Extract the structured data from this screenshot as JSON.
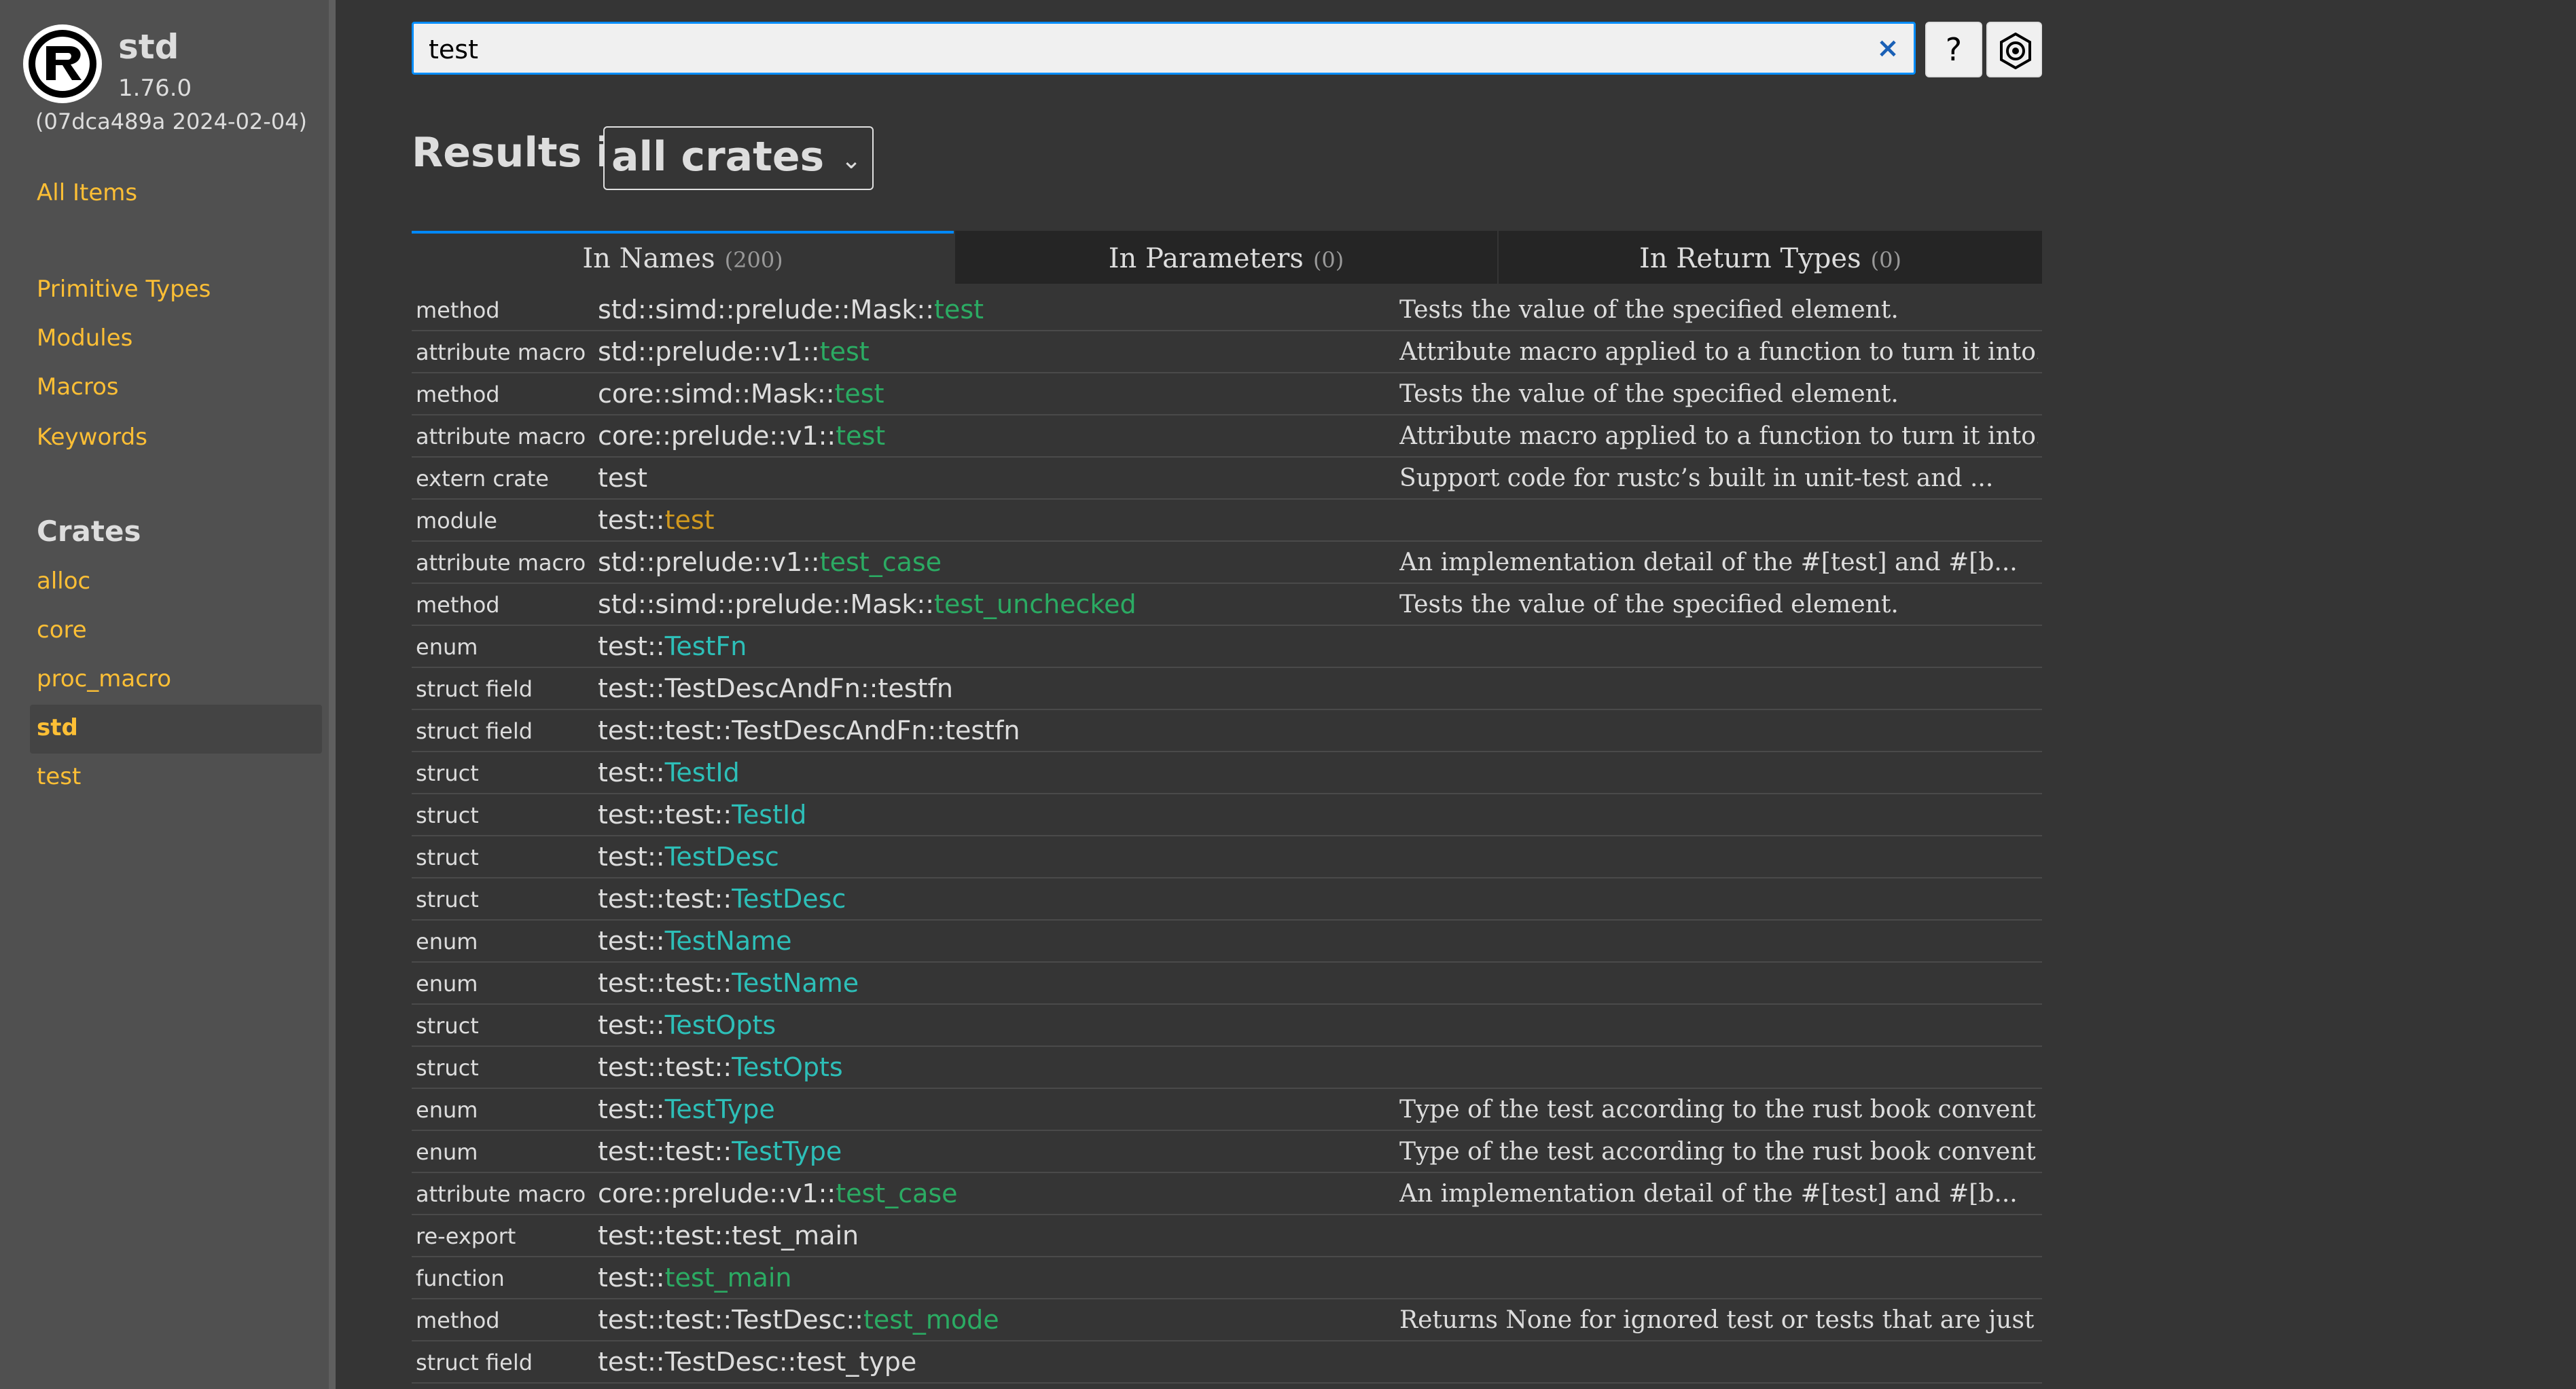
{
  "sidebar": {
    "crate_name": "std",
    "version": "1.76.0",
    "hash": "(07dca489a 2024-02-04)",
    "all_items": "All Items",
    "sections": [
      "Primitive Types",
      "Modules",
      "Macros",
      "Keywords"
    ],
    "crates_heading": "Crates",
    "crates": [
      "alloc",
      "core",
      "proc_macro",
      "std",
      "test"
    ],
    "current_crate": "std"
  },
  "search": {
    "value": "test",
    "clear": "×",
    "help": "?"
  },
  "results_header": {
    "title": "Results in",
    "crate_filter": "all crates"
  },
  "tabs": [
    {
      "label": "In Names",
      "count": "(200)"
    },
    {
      "label": "In Parameters",
      "count": "(0)"
    },
    {
      "label": "In Return Types",
      "count": "(0)"
    }
  ],
  "rows": [
    {
      "kind": "method",
      "prefix": "std::simd::prelude::Mask::",
      "name": "test",
      "style": "method",
      "desc": "Tests the value of the specified element."
    },
    {
      "kind": "attribute macro",
      "prefix": "std::prelude::v1::",
      "name": "test",
      "style": "method",
      "desc": "Attribute macro applied to a function to turn it into..."
    },
    {
      "kind": "method",
      "prefix": "core::simd::Mask::",
      "name": "test",
      "style": "method",
      "desc": "Tests the value of the specified element."
    },
    {
      "kind": "attribute macro",
      "prefix": "core::prelude::v1::",
      "name": "test",
      "style": "method",
      "desc": "Attribute macro applied to a function to turn it into..."
    },
    {
      "kind": "extern crate",
      "prefix": "test",
      "name": "",
      "style": "plain",
      "desc": "Support code for rustc’s built in unit-test and ..."
    },
    {
      "kind": "module",
      "prefix": "test::",
      "name": "test",
      "style": "mod",
      "desc": ""
    },
    {
      "kind": "attribute macro",
      "prefix": "std::prelude::v1::",
      "name": "test_case",
      "style": "method",
      "desc": "An implementation detail of the #[test] and #[b..."
    },
    {
      "kind": "method",
      "prefix": "std::simd::prelude::Mask::",
      "name": "test_unchecked",
      "style": "method",
      "desc": "Tests the value of the specified element."
    },
    {
      "kind": "enum",
      "prefix": "test::",
      "name": "TestFn",
      "style": "type",
      "desc": ""
    },
    {
      "kind": "struct field",
      "prefix": "test::TestDescAndFn::testfn",
      "name": "",
      "style": "plain",
      "desc": ""
    },
    {
      "kind": "struct field",
      "prefix": "test::test::TestDescAndFn::testfn",
      "name": "",
      "style": "plain",
      "desc": ""
    },
    {
      "kind": "struct",
      "prefix": "test::",
      "name": "TestId",
      "style": "type",
      "desc": ""
    },
    {
      "kind": "struct",
      "prefix": "test::test::",
      "name": "TestId",
      "style": "type",
      "desc": ""
    },
    {
      "kind": "struct",
      "prefix": "test::",
      "name": "TestDesc",
      "style": "type",
      "desc": ""
    },
    {
      "kind": "struct",
      "prefix": "test::test::",
      "name": "TestDesc",
      "style": "type",
      "desc": ""
    },
    {
      "kind": "enum",
      "prefix": "test::",
      "name": "TestName",
      "style": "type",
      "desc": ""
    },
    {
      "kind": "enum",
      "prefix": "test::test::",
      "name": "TestName",
      "style": "type",
      "desc": ""
    },
    {
      "kind": "struct",
      "prefix": "test::",
      "name": "TestOpts",
      "style": "type",
      "desc": ""
    },
    {
      "kind": "struct",
      "prefix": "test::test::",
      "name": "TestOpts",
      "style": "type",
      "desc": ""
    },
    {
      "kind": "enum",
      "prefix": "test::",
      "name": "TestType",
      "style": "type",
      "desc": "Type of the test according to the rust book convent..."
    },
    {
      "kind": "enum",
      "prefix": "test::test::",
      "name": "TestType",
      "style": "type",
      "desc": "Type of the test according to the rust book convent..."
    },
    {
      "kind": "attribute macro",
      "prefix": "core::prelude::v1::",
      "name": "test_case",
      "style": "method",
      "desc": "An implementation detail of the #[test] and #[b..."
    },
    {
      "kind": "re-export",
      "prefix": "test::test::test_main",
      "name": "",
      "style": "plain",
      "desc": ""
    },
    {
      "kind": "function",
      "prefix": "test::",
      "name": "test_main",
      "style": "method",
      "desc": ""
    },
    {
      "kind": "method",
      "prefix": "test::test::TestDesc::",
      "name": "test_mode",
      "style": "method",
      "desc": "Returns None for ignored test or tests that are just ..."
    },
    {
      "kind": "struct field",
      "prefix": "test::TestDesc::test_type",
      "name": "",
      "style": "plain",
      "desc": ""
    }
  ]
}
